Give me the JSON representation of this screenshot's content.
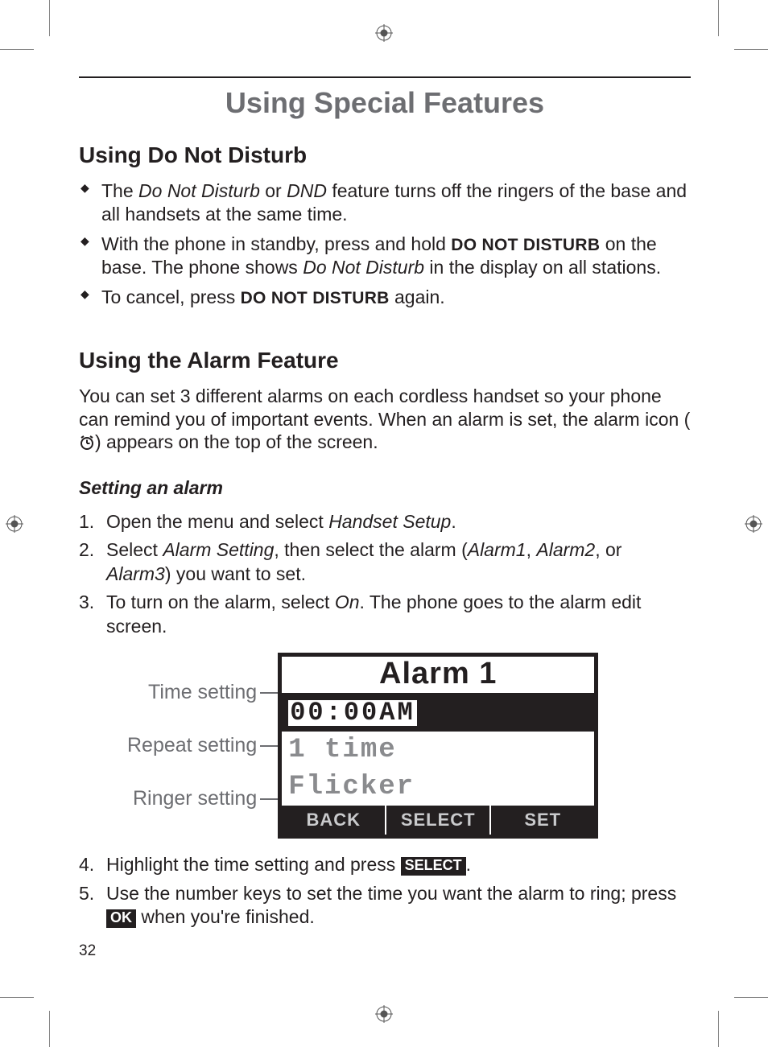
{
  "page_number": "32",
  "title": "Using Special Features",
  "dnd": {
    "heading": "Using Do Not Disturb",
    "b1_pre": "The ",
    "b1_i1": "Do Not Disturb",
    "b1_mid": " or ",
    "b1_i2": "DND",
    "b1_post": " feature turns off the ringers of the base and all handsets at the same time.",
    "b2_pre": "With the phone in standby, press and hold ",
    "b2_key": "DO NOT DISTURB",
    "b2_mid": " on the base. The phone shows ",
    "b2_i": "Do Not Disturb",
    "b2_post": " in the display on all stations.",
    "b3_pre": "To cancel, press ",
    "b3_key": "DO NOT DISTURB",
    "b3_post": " again."
  },
  "alarm": {
    "heading": "Using the Alarm Feature",
    "intro_pre": "You can set 3 different alarms on each cordless handset so your phone can remind you of important events. When an alarm is set, the alarm icon (",
    "intro_post": ") appears on the top of the screen.",
    "sub": "Setting an alarm",
    "s1_pre": "Open the menu and select ",
    "s1_i": "Handset Setup",
    "s1_post": ".",
    "s2_pre": "Select ",
    "s2_i1": "Alarm Setting",
    "s2_mid1": ", then select the alarm (",
    "s2_i2": "Alarm1",
    "s2_mid2": ", ",
    "s2_i3": "Alarm2",
    "s2_mid3": ", or ",
    "s2_i4": "Alarm3",
    "s2_post": ") you want to set.",
    "s3_pre": "To turn on the alarm, select ",
    "s3_i": "On",
    "s3_post": ". The phone goes to the alarm edit screen.",
    "s4_pre": "Highlight the time setting and press ",
    "s4_key": "SELECT",
    "s4_post": ".",
    "s5_pre": "Use the number keys to set the time you want the alarm to ring; press ",
    "s5_key": "OK",
    "s5_post": " when you're finished."
  },
  "lcd": {
    "label_time": "Time setting",
    "label_repeat": "Repeat setting",
    "label_ringer": "Ringer setting",
    "screen_title": "Alarm 1",
    "time_value": "00:00AM",
    "repeat_value": "1 time",
    "ringer_value": "Flicker",
    "softkeys": {
      "left": "BACK",
      "center": "SELECT",
      "right": "SET"
    }
  }
}
